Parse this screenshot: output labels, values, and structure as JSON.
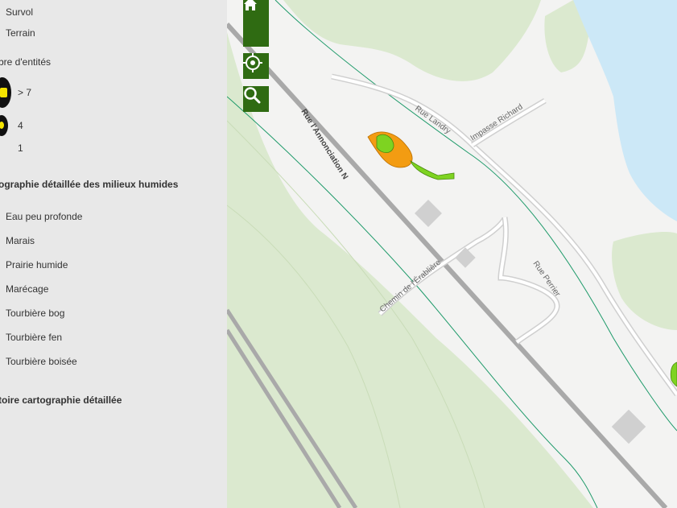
{
  "legend": {
    "basemap_items": [
      "Survol",
      "Terrain"
    ],
    "cluster_title": "bre d'entités",
    "cluster_items": [
      "> 7",
      "4",
      "1"
    ],
    "wetland_title": "ographie détaillée des milieux humides",
    "wetland_items": [
      "Eau peu profonde",
      "Marais",
      "Prairie humide",
      "Marécage",
      "Tourbière bog",
      "Tourbière fen",
      "Tourbière boisée"
    ],
    "history_title": "toire cartographie détaillée"
  },
  "map": {
    "tools": {
      "home": "home-icon",
      "zoom_out": "minus-icon",
      "locate": "locate-icon",
      "search": "search-icon"
    },
    "colors": {
      "marais": "#f39c12",
      "prairie": "#7ed321",
      "forest": "#dbe9cf",
      "water": "#cce8f7",
      "stream": "#1e9a6a",
      "tool_bg": "#2f6b12"
    },
    "street_labels": {
      "annonciation": "Rue l'Annonciation N",
      "landry": "Rue Landry",
      "richard": "Impasse Richard",
      "erabliere": "Chemin de l'Érablière",
      "perrier": "Rue Perrier"
    }
  }
}
